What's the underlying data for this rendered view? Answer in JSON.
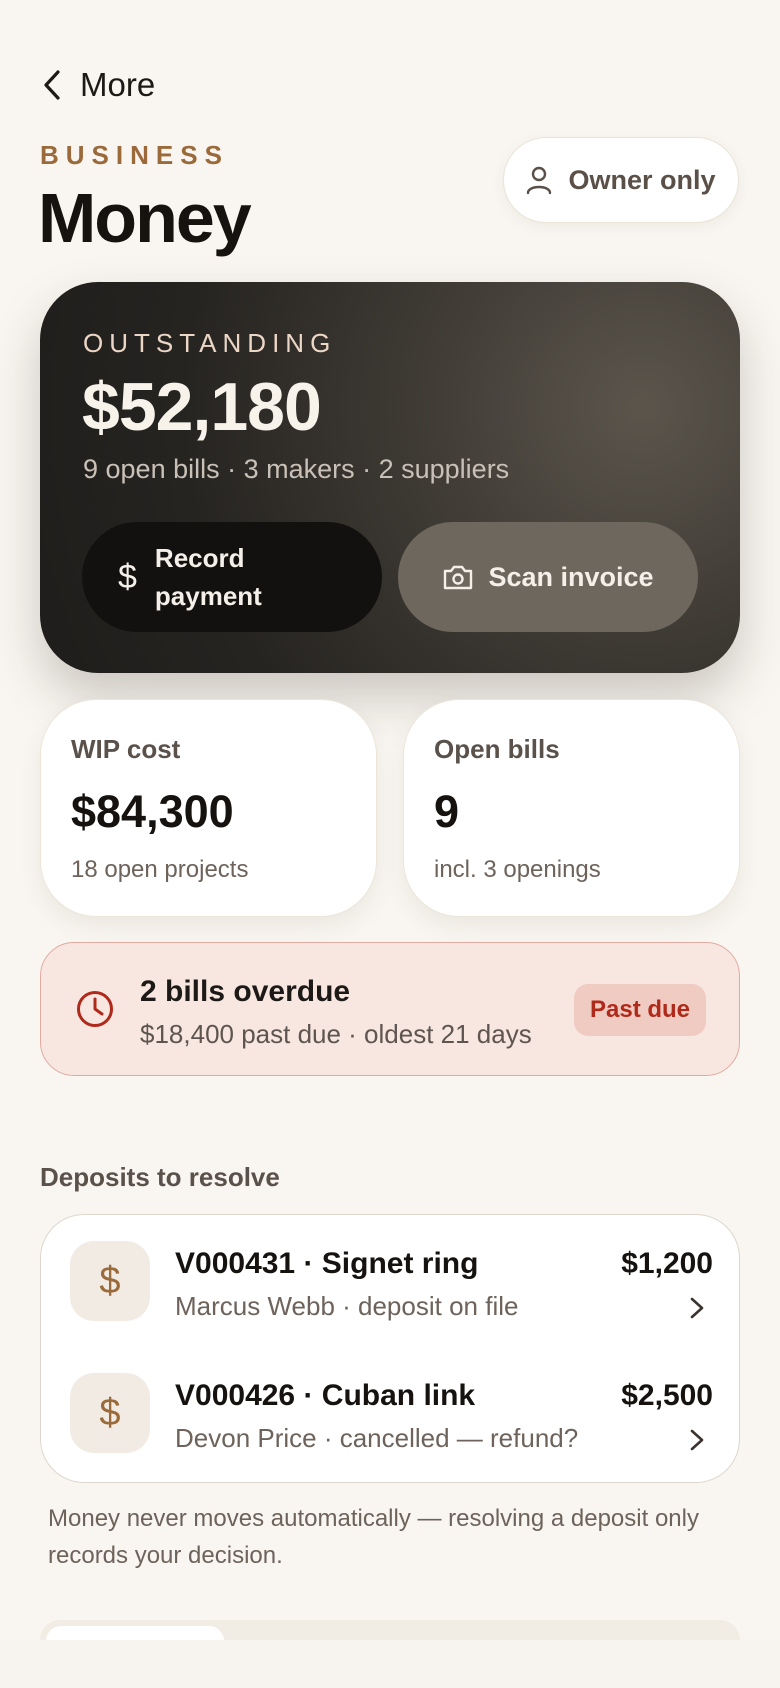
{
  "nav": {
    "back_label": "More"
  },
  "header": {
    "eyebrow": "BUSINESS",
    "title": "Money",
    "owner_badge": "Owner only"
  },
  "hero": {
    "label": "OUTSTANDING",
    "amount": "$52,180",
    "subtitle": "9 open bills · 3 makers · 2 suppliers",
    "record_icon": "$",
    "record_line1": "Record",
    "record_line2": "payment",
    "scan_label": "Scan invoice"
  },
  "stats": [
    {
      "label": "WIP cost",
      "value": "$84,300",
      "sub": "18 open projects"
    },
    {
      "label": "Open bills",
      "value": "9",
      "sub": "incl. 3 openings"
    }
  ],
  "alert": {
    "title": "2 bills overdue",
    "subtitle": "$18,400 past due · oldest 21 days",
    "badge": "Past due",
    "icon": "clock-icon",
    "color": "#b02a1c"
  },
  "deposits": {
    "section_title": "Deposits to resolve",
    "items": [
      {
        "icon": "$",
        "title": "V000431 · Signet ring",
        "subtitle": "Marcus Webb · deposit on file",
        "amount": "$1,200"
      },
      {
        "icon": "$",
        "title": "V000426 · Cuban link",
        "subtitle": "Devon Price · cancelled — refund?",
        "amount": "$2,500"
      }
    ],
    "footnote": "Money never moves automatically — resolving a deposit only records your decision."
  },
  "colors": {
    "background": "#f9f6f1",
    "accent": "#9a6a3a",
    "danger": "#b02a1c",
    "hero_dark": "#262421"
  }
}
